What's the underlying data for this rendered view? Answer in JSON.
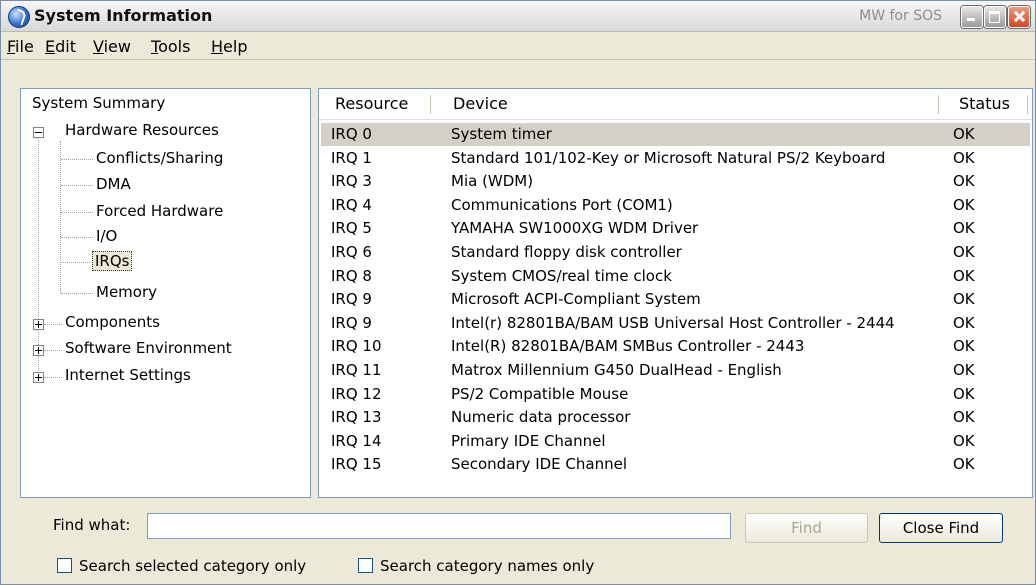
{
  "window": {
    "title": "System Information",
    "owner": "MW for SOS",
    "controls": [
      "minimize-icon",
      "maximize-icon",
      "close-icon"
    ]
  },
  "menu": [
    "File",
    "Edit",
    "View",
    "Tools",
    "Help"
  ],
  "menu_mnemonics": [
    "F",
    "E",
    "V",
    "T",
    "H"
  ],
  "tree": {
    "root": "System Summary",
    "hardware": "Hardware Resources",
    "hardware_children": [
      "Conflicts/Sharing",
      "DMA",
      "Forced Hardware",
      "I/O",
      "IRQs",
      "Memory"
    ],
    "selected": "IRQs",
    "collapsed": [
      "Components",
      "Software Environment",
      "Internet Settings"
    ]
  },
  "list": {
    "columns": [
      "Resource",
      "Device",
      "Status"
    ],
    "rows": [
      {
        "resource": "IRQ 0",
        "device": "System timer",
        "status": "OK"
      },
      {
        "resource": "IRQ 1",
        "device": "Standard 101/102-Key or Microsoft Natural PS/2 Keyboard",
        "status": "OK"
      },
      {
        "resource": "IRQ 3",
        "device": "Mia (WDM)",
        "status": "OK"
      },
      {
        "resource": "IRQ 4",
        "device": "Communications Port (COM1)",
        "status": "OK"
      },
      {
        "resource": "IRQ 5",
        "device": "YAMAHA SW1000XG WDM Driver",
        "status": "OK"
      },
      {
        "resource": "IRQ 6",
        "device": "Standard floppy disk controller",
        "status": "OK"
      },
      {
        "resource": "IRQ 8",
        "device": "System CMOS/real time clock",
        "status": "OK"
      },
      {
        "resource": "IRQ 9",
        "device": "Microsoft ACPI-Compliant System",
        "status": "OK"
      },
      {
        "resource": "IRQ 9",
        "device": "Intel(r) 82801BA/BAM USB Universal Host Controller - 2444",
        "status": "OK"
      },
      {
        "resource": "IRQ 10",
        "device": "Intel(R) 82801BA/BAM SMBus Controller - 2443",
        "status": "OK"
      },
      {
        "resource": "IRQ 11",
        "device": "Matrox Millennium G450 DualHead - English",
        "status": "OK"
      },
      {
        "resource": "IRQ 12",
        "device": "PS/2 Compatible Mouse",
        "status": "OK"
      },
      {
        "resource": "IRQ 13",
        "device": "Numeric data processor",
        "status": "OK"
      },
      {
        "resource": "IRQ 14",
        "device": "Primary IDE Channel",
        "status": "OK"
      },
      {
        "resource": "IRQ 15",
        "device": "Secondary IDE Channel",
        "status": "OK"
      }
    ],
    "selected_index": 0
  },
  "find": {
    "label": "Find what:",
    "value": "",
    "find_button": "Find",
    "close_button": "Close Find",
    "check_selected": "Search selected category only",
    "check_names": "Search category names only"
  }
}
